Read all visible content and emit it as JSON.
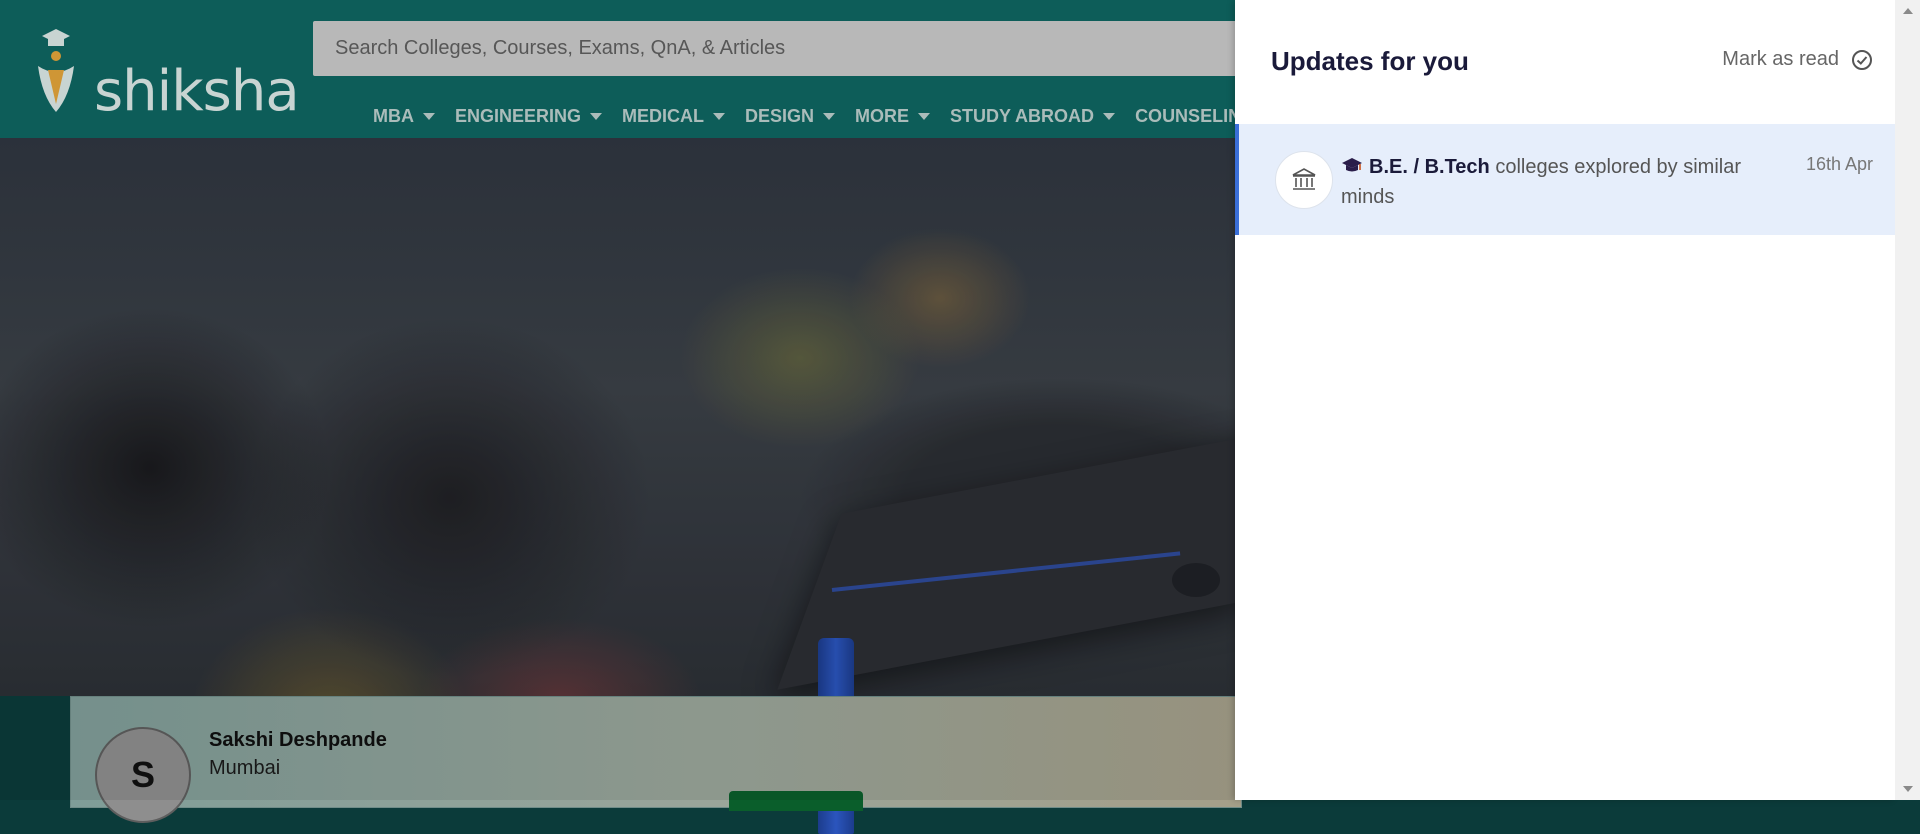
{
  "header": {
    "logo_text": "shiksha",
    "search_placeholder": "Search Colleges, Courses, Exams, QnA, & Articles",
    "nav": [
      {
        "label": "MBA"
      },
      {
        "label": "ENGINEERING"
      },
      {
        "label": "MEDICAL"
      },
      {
        "label": "DESIGN"
      },
      {
        "label": "MORE"
      },
      {
        "label": "STUDY ABROAD"
      },
      {
        "label": "COUNSELIN"
      }
    ]
  },
  "profile": {
    "initial": "S",
    "name": "Sakshi Deshpande",
    "city": "Mumbai"
  },
  "drawer": {
    "title": "Updates for you",
    "mark_read_label": "Mark as read",
    "notifications": [
      {
        "bold": "B.E. / B.Tech",
        "text": " colleges explored by similar minds",
        "date": "16th Apr"
      }
    ]
  },
  "colors": {
    "header_bg": "#0f6561",
    "notif_bg": "#e6eefb",
    "notif_accent": "#3a6fd8"
  }
}
